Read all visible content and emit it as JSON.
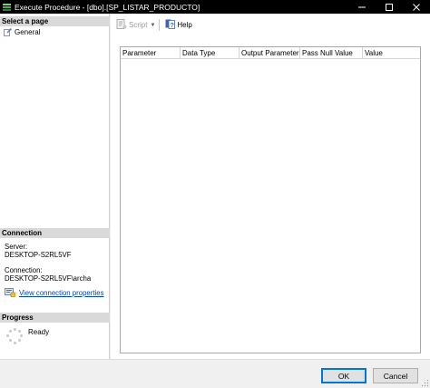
{
  "window": {
    "title": "Execute Procedure - [dbo].[SP_LISTAR_PRODUCTO]",
    "controls": [
      "minimize-icon",
      "maximize-icon",
      "close-icon"
    ]
  },
  "left_panel": {
    "select_page_header": "Select a page",
    "pages": [
      {
        "label": "General",
        "icon": "wrench-page-icon"
      }
    ],
    "connection_header": "Connection",
    "server_label": "Server:",
    "server_value": "DESKTOP-S2RL5VF",
    "connection_label": "Connection:",
    "connection_value": "DESKTOP-S2RL5VF\\archa",
    "view_connection_link": "View connection properties",
    "progress_header": "Progress",
    "progress_status": "Ready"
  },
  "toolbar": {
    "script_label": "Script",
    "help_label": "Help"
  },
  "grid": {
    "columns": [
      "Parameter",
      "Data Type",
      "Output Parameter",
      "Pass Null Value",
      "Value"
    ],
    "rows": []
  },
  "buttons": {
    "ok_label": "OK",
    "cancel_label": "Cancel"
  },
  "colors": {
    "title_bar": "#000000",
    "section_header": "#d9d9d9",
    "link": "#0645ad",
    "ok_border": "#0078d7"
  }
}
